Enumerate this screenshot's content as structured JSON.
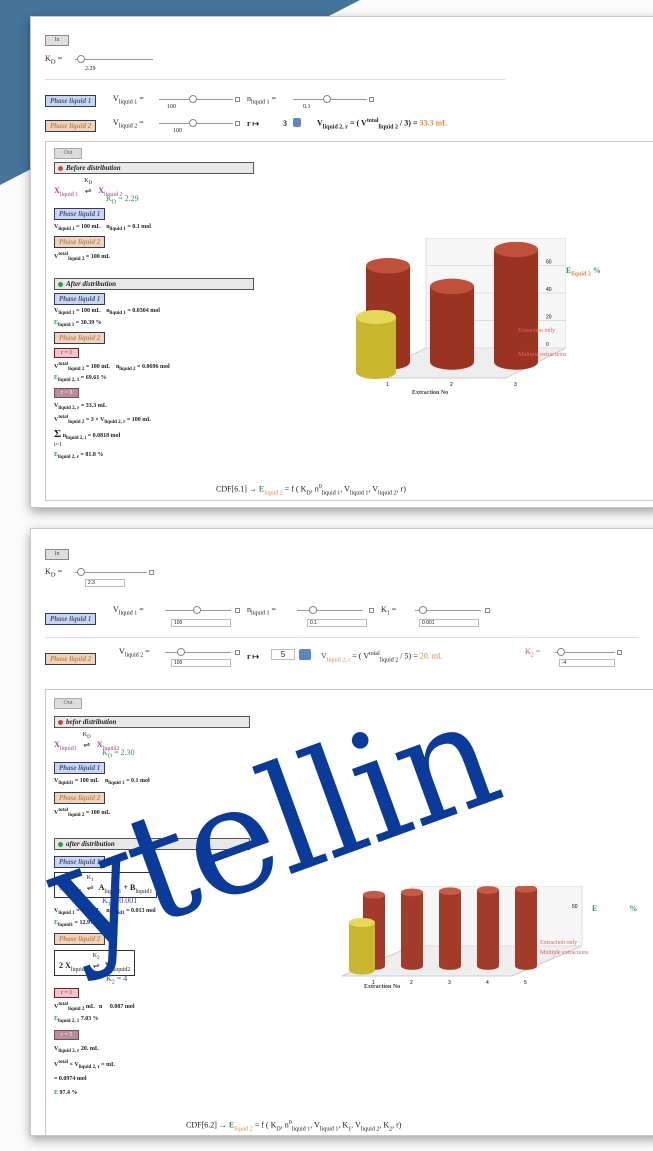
{
  "panel1": {
    "in_label": "In",
    "kd_label": "K",
    "kd_sub": "D",
    "kd_value": "2.29",
    "phase1_label": "Phase liquid 1",
    "v1_label": "V",
    "v1_sub": "liquid 1",
    "v1_value": "100",
    "n_label": "n",
    "n_sub": "liquid 1",
    "n_value": "0.1",
    "phase2_label": "Phase liquid 2",
    "v2_label": "V",
    "v2_sub": "liquid 2",
    "v2_value": "100",
    "r_label": "r ↦",
    "r_value": "3",
    "vr_formula": "V",
    "vr_sub": "liquid 2, r",
    "vr_rest": "= ( V",
    "vr_total": "total",
    "vr_total_sub": "liquid 2",
    "vr_div": "/ 3) =",
    "vr_result": "33.3 mL",
    "out_label": "Out",
    "before_header": "Before distribution",
    "eq_left": "X",
    "eq_left_sub": "liquid 1",
    "eq_k": "K",
    "eq_k_sub": "D",
    "eq_right": "X",
    "eq_right_sub": "liquid 2",
    "kd_display": "K",
    "kd_display_sub": "D",
    "kd_display_val": "= 2.29",
    "b_phase1": "Phase liquid 1",
    "b_line1": "V",
    "b_line1_sub": "liquid 1",
    "b_line1_val": "= 100 mL",
    "b_line1_n": "n",
    "b_line1_n_sub": "liquid 1",
    "b_line1_n_val": "= 0.1 mol",
    "b_phase2": "Phase liquid 2",
    "b_line2": "V",
    "b_line2_sup": "total",
    "b_line2_sub": "liquid 2",
    "b_line2_val": "= 100 mL",
    "after_header": "After distribution",
    "a_phase1": "Phase liquid 1",
    "a_line1": "V",
    "a_line1_sub": "liquid 1",
    "a_line1_val": "= 100 mL",
    "a_line1_n": "n",
    "a_line1_n_sub": "liquid 1",
    "a_line1_n_val": "= 0.0304 mol",
    "a_e1": "E",
    "a_e1_sub": "liquid 1",
    "a_e1_val": "= 30.39 %",
    "a_phase2": "Phase liquid 2",
    "r1_label": "r = 1",
    "r1_line1": "V",
    "r1_line1_sup": "total",
    "r1_line1_sub": "liquid 2",
    "r1_line1_val": "= 100 mL",
    "r1_line1_n": "n",
    "r1_line1_n_sub": "liquid 2",
    "r1_line1_n_val": "= 0.0696 mol",
    "r1_e": "E",
    "r1_e_sub": "liquid 2, 1",
    "r1_e_val": "= 69.61 %",
    "r3_label": "r = 3",
    "r3_line1": "V",
    "r3_line1_sub": "liquid 2, r",
    "r3_line1_val": "= 33.3 mL",
    "r3_line2": "V",
    "r3_line2_sup": "total",
    "r3_line2_sub": "liquid 2",
    "r3_line2_val": "= 3 × V",
    "r3_line2_sub2": "liquid 2, r",
    "r3_line2_val2": "= 100 mL",
    "r3_sum": "Σ",
    "r3_sum_top": "r",
    "r3_sum_bottom": "i=1",
    "r3_sum_n": "n",
    "r3_sum_n_sub": "liquid 2, i",
    "r3_sum_val": "= 0.0818 mol",
    "r3_e": "E",
    "r3_e_sub": "liquid 2, r",
    "r3_e_val": "= 81.8 %",
    "footer_cdf": "CDF[6.1] →",
    "footer_e": "E",
    "footer_e_sub": "liquid 2",
    "footer_eq": "= f ( K",
    "footer_kd_sub": "D",
    "footer_rest": ", n",
    "footer_n_sup": "0",
    "footer_n_sub": "liquid 1",
    "footer_v1": ", V",
    "footer_v1_sub": "liquid 1",
    "footer_v2": ", V",
    "footer_v2_sub": "liquid 2",
    "footer_end": ", r)"
  },
  "panel2": {
    "in_label": "In",
    "kd_label": "K",
    "kd_sub": "D",
    "kd_value": "2.3",
    "phase1_label": "Phase liquid 1",
    "v1_label": "V",
    "v1_sub": "liquid 1",
    "v1_value": "100",
    "n_label": "n",
    "n_sub": "liquid 1",
    "n_value": "0.1",
    "k1_label": "K",
    "k1_sub": "1",
    "k1_value": "0.001",
    "phase2_label": "Phase liquid 2",
    "v2_label": "V",
    "v2_sub": "liquid 2",
    "v2_value": "100",
    "r_label": "r ↦",
    "r_value": "5",
    "vr_formula": "V",
    "vr_sub": "liquid 2, r",
    "vr_rest": "= ( V",
    "vr_total": "total",
    "vr_total_sub": "liquid 2",
    "vr_div": "/ 5) =",
    "vr_result": "20. mL",
    "k2_label": "K",
    "k2_sub": "2",
    "k2_value": ".4",
    "out_label": "Out",
    "before_header": "befor distribution",
    "eq_left": "X",
    "eq_left_sub": "liquid1",
    "eq_k": "K",
    "eq_k_sub": "D",
    "eq_right": "X",
    "eq_right_sub": "liquid2",
    "kd_display": "K",
    "kd_display_sub": "D",
    "kd_display_val": "= 2.30",
    "b_phase1": "Phase liquid 1",
    "b_line1": "V",
    "b_line1_sub": "liquid1",
    "b_line1_val": "= 100 mL",
    "b_line1_n": "n",
    "b_line1_n_sub": "liquid 1",
    "b_line1_n_val": "= 0.1 mol",
    "b_phase2": "Phase liquid 2",
    "b_line2": "V",
    "b_line2_sup": "total",
    "b_line2_sub": "liquid 2",
    "b_line2_val": "= 100 mL",
    "after_header": "after distribution",
    "a_phase1": "Phase liquid 1",
    "a_box1": "X",
    "a_box1_sub": "liquid1",
    "a_box1_k": "K",
    "a_box1_k_sub": "1",
    "a_box1_rest": "A",
    "a_box1_rest_sub": "liquid1",
    "a_box1_plus": "+ B",
    "a_box1_plus_sub": "liquid1",
    "a_k1": "K",
    "a_k1_sub": "1",
    "a_k1_val": "= 0.001",
    "a_line1": "V",
    "a_line1_sub": "liquid 1",
    "a_line1_val": "= 100 mL",
    "a_line1_n": "n",
    "a_line1_n_sub": "liquid1",
    "a_line1_n_val": "= 0.013 mol",
    "a_e1": "E",
    "a_e1_sub": "liquid1",
    "a_e1_val": "= 12.97 %",
    "a_phase2": "Phase liquid 2",
    "a_box2": "2 X",
    "a_box2_sub": "liquid2",
    "a_box2_k": "K",
    "a_box2_k_sub": "2",
    "a_box2_rest": "X",
    "a_box2_rest_sub": "2",
    "a_box2_rest_sub2": "liquid2",
    "a_k2": "K",
    "a_k2_sub": "2",
    "a_k2_val": "= 4",
    "r1_label": "r = 1",
    "r1_line1": "V",
    "r1_line1_sup": "total",
    "r1_line1_sub": "liquid 2",
    "r1_line1_val": "mL",
    "r1_line1_n": "n",
    "r1_line1_n_val": "0.087 mol",
    "r1_e": "E",
    "r1_e_sub": "liquid 2, 1",
    "r1_e_val": "7.03 %",
    "r5_label": "r = 5",
    "r5_line1": "V",
    "r5_line1_sub": "liquid 2, r",
    "r5_line1_val": "20. mL",
    "r5_line2": "V",
    "r5_line2_sup": "total",
    "r5_line2_val": "× V",
    "r5_line2_sub2": "liquid 2, r",
    "r5_line2_val2": "=",
    "r5_line2_val3": "mL",
    "r5_sum_val": "= 0.0974 mol",
    "r5_e": "E",
    "r5_e_val": "97.4 %",
    "footer_cdf": "CDF[6.2] →",
    "footer_e": "E",
    "footer_e_sub": "liquid 2",
    "footer_eq": "= f ( K",
    "footer_kd_sub": "D",
    "footer_rest": ", n",
    "footer_n_sup": "0",
    "footer_n_sub": "liquid 1",
    "footer_v1": ", V",
    "footer_v1_sub": "liquid 1",
    "footer_k1": ", K",
    "footer_k1_sub": "1",
    "footer_v2": ", V",
    "footer_v2_sub": "liquid 2",
    "footer_k2": ", K",
    "footer_k2_sub": "2",
    "footer_end": ", r)"
  },
  "watermark": "ytellin",
  "chart_data": [
    {
      "type": "bar",
      "xlabel": "Extraction No",
      "legend": [
        {
          "name": "Extraction only",
          "color": "#e06060"
        },
        {
          "name": "Multiple extractions",
          "color": "#e06060"
        }
      ],
      "ylabel": "E",
      "ylabel_sub": "liquid 2",
      "ylabel_unit": "%",
      "categories": [
        "1",
        "2",
        "3"
      ],
      "values": [
        70,
        55,
        81.8
      ],
      "single_value": 40,
      "yticks": [
        "0",
        "20",
        "40",
        "60",
        "80"
      ],
      "ylim": [
        0,
        80
      ]
    },
    {
      "type": "bar",
      "xlabel": "Extraction No",
      "legend_short": "Extraction only",
      "legend_short2": "Multiple extractions",
      "ylabel": "E",
      "ylabel_unit": "%",
      "categories": [
        "1",
        "2",
        "3",
        "4",
        "5"
      ],
      "values": [
        60,
        62,
        63,
        64,
        65
      ],
      "single_value": 40,
      "ytick": "50",
      "ylim": [
        0,
        80
      ]
    }
  ]
}
